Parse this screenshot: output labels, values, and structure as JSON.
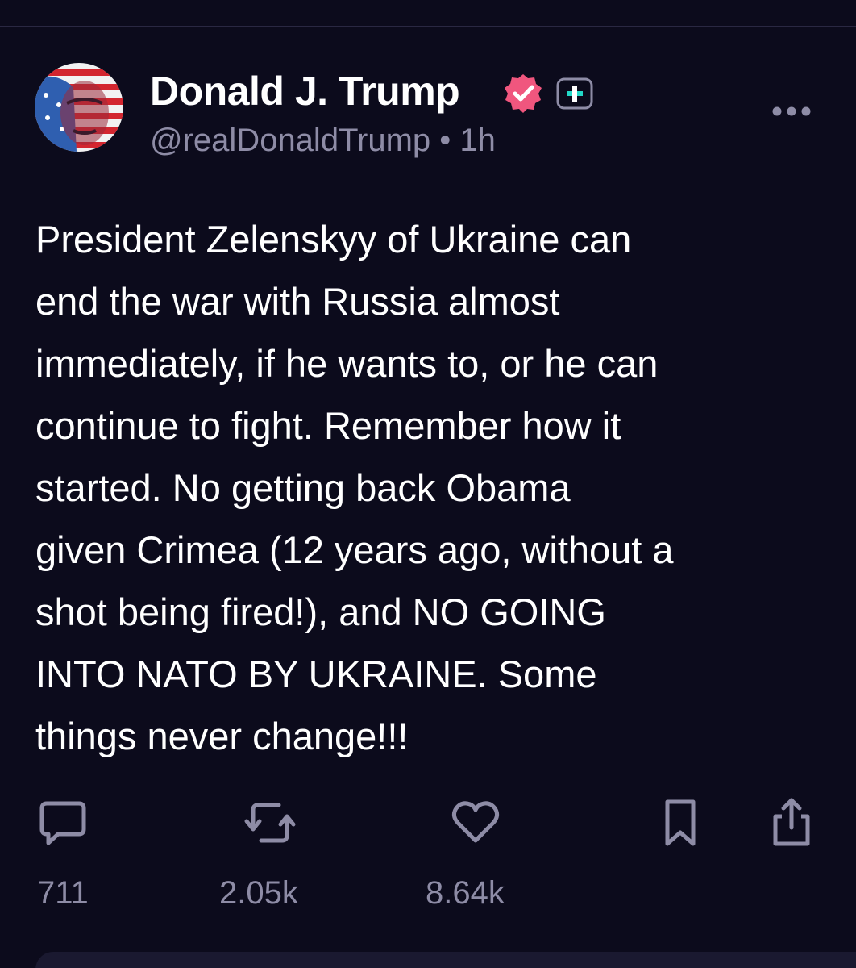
{
  "post": {
    "author": {
      "display_name": "Donald J. Trump",
      "handle_line": "@realDonaldTrump • 1h",
      "verified_color": "#f0567e",
      "plus_badge_color": "#22d8c8"
    },
    "text": "President Zelenskyy of Ukraine can\nend the war with Russia almost\nimmediately, if he wants to, or he can\ncontinue to fight. Remember how it\nstarted. No getting back Obama\ngiven Crimea (12 years ago, without a\nshot being fired!), and NO GOING\nINTO NATO BY UKRAINE. Some\nthings never change!!!",
    "actions": {
      "reply": {
        "icon": "comment-icon",
        "count": "711"
      },
      "repost": {
        "icon": "repost-icon",
        "count": "2.05k"
      },
      "like": {
        "icon": "heart-icon",
        "count": "8.64k"
      },
      "bookmark": {
        "icon": "bookmark-icon"
      },
      "share": {
        "icon": "share-icon"
      }
    }
  },
  "colors": {
    "background": "#0c0b1c",
    "text": "#ffffff",
    "muted": "#8e8ca6"
  }
}
